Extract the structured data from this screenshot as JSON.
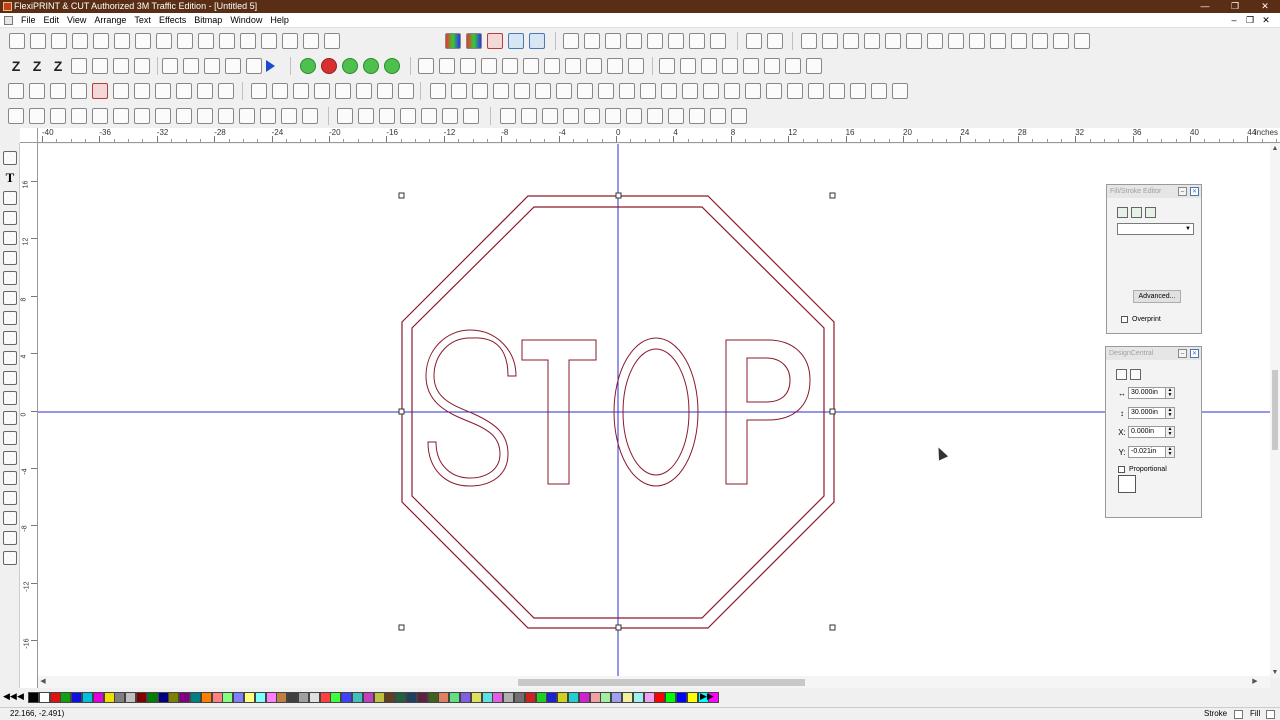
{
  "window": {
    "title": "FlexiPRINT & CUT Authorized 3M Traffic Edition - [Untitled 5]",
    "controls": [
      "—",
      "❐",
      "✕"
    ]
  },
  "menubar": {
    "items": [
      "File",
      "Edit",
      "View",
      "Arrange",
      "Text",
      "Effects",
      "Bitmap",
      "Window",
      "Help"
    ],
    "mdi_controls": [
      "–",
      "❐",
      "✕"
    ]
  },
  "ruler": {
    "units": "inches",
    "h_labels": [
      "-40",
      "-36",
      "-32",
      "-28",
      "-24",
      "-20",
      "-16",
      "-12",
      "-8",
      "-4",
      "0",
      "4",
      "8",
      "12",
      "16",
      "20",
      "24",
      "28",
      "32",
      "36",
      "40",
      "44"
    ],
    "v_labels": [
      "16",
      "12",
      "8",
      "4",
      "0",
      "-4",
      "-8",
      "-12",
      "-16"
    ]
  },
  "canvas": {
    "sign_text": "STOP",
    "outline_color": "#8b1a2b",
    "guide_color": "#2b2bd6"
  },
  "fill_stroke_editor": {
    "title": "Fill/Stroke Editor",
    "icons": [
      "fill-icon",
      "stroke-icon",
      "transparency-icon"
    ],
    "dropdown_value": "",
    "advanced_label": "Advanced...",
    "overprint_label": "Overprint",
    "overprint_checked": false
  },
  "design_central": {
    "title": "DesignCentral",
    "icons": [
      "size-icon",
      "rotate-icon"
    ],
    "fields": [
      {
        "symbol": "↔",
        "value": "30.000in"
      },
      {
        "symbol": "↕",
        "value": "30.000in"
      },
      {
        "symbol": "X:",
        "value": "0.000in"
      },
      {
        "symbol": "Y:",
        "value": "-0.021in"
      }
    ],
    "proportional_label": "Proportional",
    "proportional_checked": false
  },
  "palette": {
    "colors": [
      "#000000",
      "#ffffff",
      "#e01010",
      "#10a010",
      "#1010e0",
      "#00c0e0",
      "#e000e0",
      "#f0e000",
      "#808080",
      "#c0c0c0",
      "#800000",
      "#008000",
      "#000080",
      "#808000",
      "#800080",
      "#008080",
      "#ff8000",
      "#ff8080",
      "#80ff80",
      "#8080ff",
      "#ffff80",
      "#80ffff",
      "#ff80ff",
      "#c08040",
      "#404040",
      "#a0a0a0",
      "#e0e0e0",
      "#ff4040",
      "#40ff40",
      "#4040ff",
      "#40c0c0",
      "#c040c0",
      "#c0c040",
      "#604020",
      "#206040",
      "#204060",
      "#602040",
      "#406020",
      "#e08060",
      "#60e080",
      "#8060e0",
      "#e0e060",
      "#60e0e0",
      "#e060e0",
      "#b0b0b0",
      "#707070",
      "#d02020",
      "#20d020",
      "#2020d0",
      "#d0d020",
      "#20d0d0",
      "#d020d0",
      "#f0a0a0",
      "#a0f0a0",
      "#a0a0f0",
      "#f0f0a0",
      "#a0f0f0",
      "#f0a0f0",
      "#ff0000",
      "#00ff00",
      "#0000ff",
      "#ffff00",
      "#00ffff",
      "#ff00ff"
    ]
  },
  "status": {
    "coords": "22.166,   -2.491)",
    "stroke_label": "Stroke",
    "fill_label": "Fill"
  }
}
